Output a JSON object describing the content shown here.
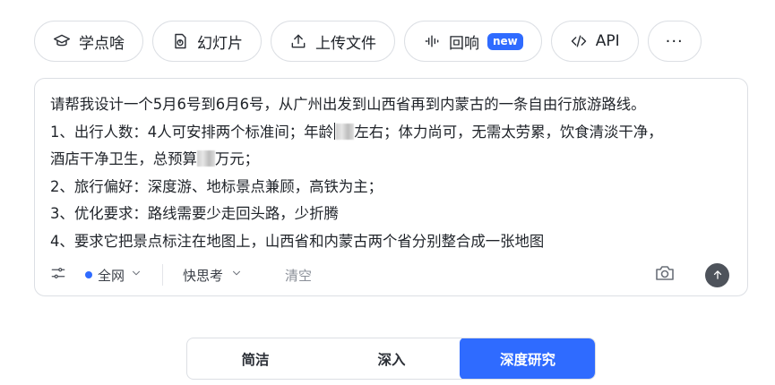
{
  "toolbar": {
    "items": [
      {
        "label": "学点啥",
        "icon": "graduation-cap-icon"
      },
      {
        "label": "幻灯片",
        "icon": "slides-file-icon"
      },
      {
        "label": "上传文件",
        "icon": "upload-icon"
      },
      {
        "label": "回响",
        "icon": "audio-wave-icon",
        "badge": "new"
      },
      {
        "label": "API",
        "icon": "code-icon"
      }
    ],
    "more_label": "···"
  },
  "composer": {
    "lines": [
      "请帮我设计一个5月6号到6月6号，从广州出发到山西省再到内蒙古的一条自由行旅游路线。",
      "1、出行人数：4人可安排两个标准间；年龄",
      "左右；体力尚可，无需太劳累，饮食清淡干净，",
      "酒店干净卫生，总预算",
      "万元；",
      "2、旅行偏好：深度游、地标景点兼顾，高铁为主；",
      "3、优化要求：路线需要少走回头路，少折腾",
      "4、要求它把景点标注在地图上，山西省和内蒙古两个省分别整合成一张地图"
    ],
    "scope_label": "全网",
    "mode_label": "快思考",
    "clear_label": "清空"
  },
  "depth_selector": {
    "options": [
      "简洁",
      "深入",
      "深度研究"
    ],
    "selected": "深度研究"
  },
  "colors": {
    "accent": "#2f6bff",
    "border": "#dcdfe4",
    "send_button": "#4e535b"
  }
}
